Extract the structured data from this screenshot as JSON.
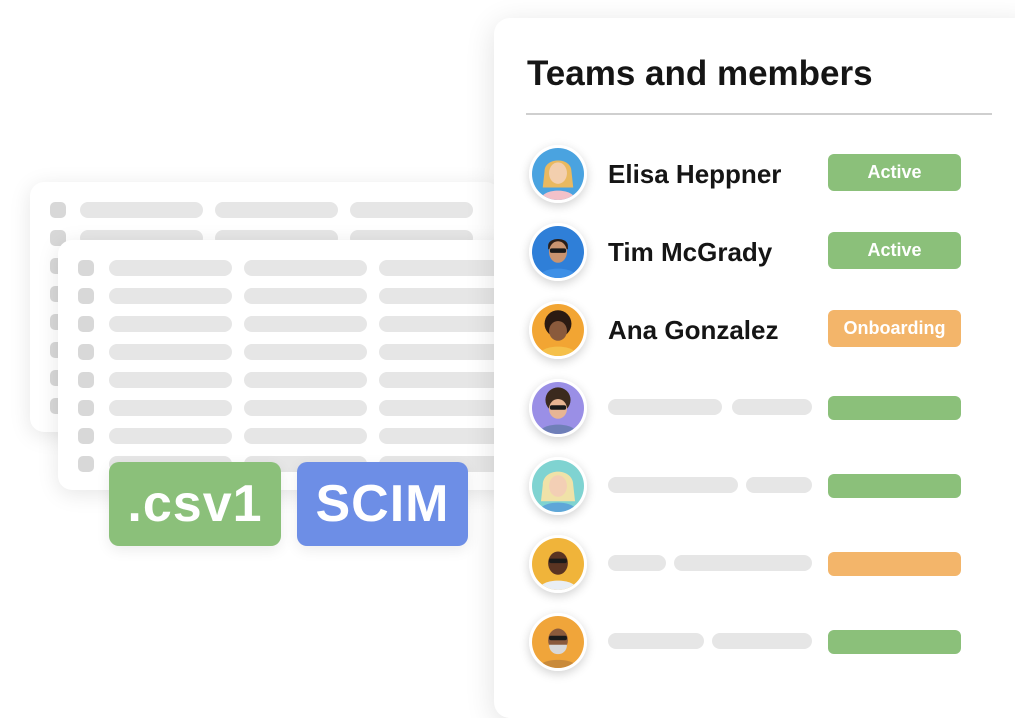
{
  "panel": {
    "title": "Teams and members",
    "members": [
      {
        "name": "Elisa Heppner",
        "status": "Active",
        "status_color": "#8bc07a",
        "avatar_bg": "#4aa3e0",
        "avatar_icon": "person-avatar-icon"
      },
      {
        "name": "Tim McGrady",
        "status": "Active",
        "status_color": "#8bc07a",
        "avatar_bg": "#2f7fd8",
        "avatar_icon": "person-avatar-icon"
      },
      {
        "name": "Ana Gonzalez",
        "status": "Onboarding",
        "status_color": "#f3b56a",
        "avatar_bg": "#f2a533",
        "avatar_icon": "person-avatar-icon"
      },
      {
        "name": "",
        "status": "",
        "status_color": "#8bc07a",
        "avatar_bg": "#9a8fe6",
        "avatar_icon": "person-avatar-icon"
      },
      {
        "name": "",
        "status": "",
        "status_color": "#8bc07a",
        "avatar_bg": "#7fd3d1",
        "avatar_icon": "person-avatar-icon"
      },
      {
        "name": "",
        "status": "",
        "status_color": "#f3b56a",
        "avatar_bg": "#f0b43a",
        "avatar_icon": "person-avatar-icon"
      },
      {
        "name": "",
        "status": "",
        "status_color": "#8bc07a",
        "avatar_bg": "#f0a53a",
        "avatar_icon": "person-avatar-icon"
      }
    ]
  },
  "import_badges": {
    "csv_label": ".csv1",
    "scim_label": "SCIM",
    "csv_color": "#8bc07a",
    "scim_color": "#6d8ee6"
  },
  "colors": {
    "active": "#8bc07a",
    "onboarding": "#f3b56a",
    "placeholder": "#e6e6e6"
  }
}
